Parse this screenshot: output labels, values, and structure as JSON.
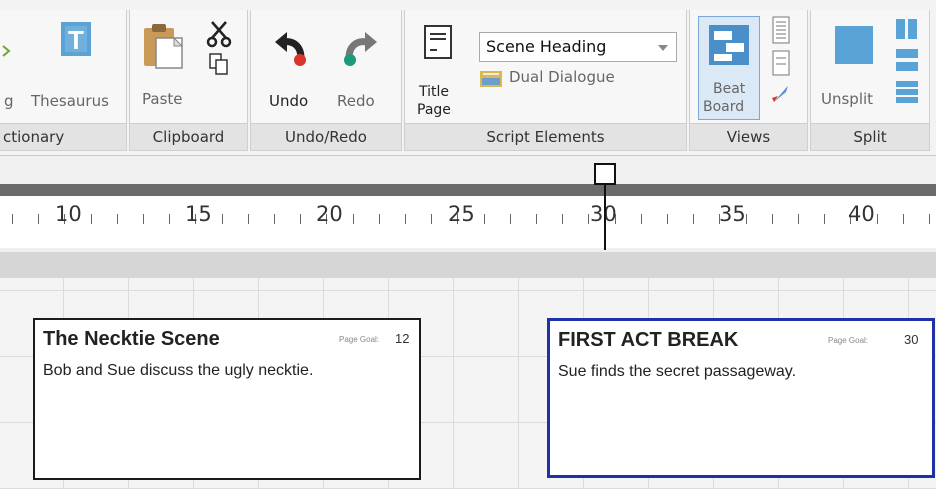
{
  "ribbon": {
    "groups": {
      "dictionary": {
        "label": "ctionary",
        "thesaurus_partial": "g",
        "thesaurus_label": "Thesaurus"
      },
      "clipboard": {
        "label": "Clipboard",
        "paste_label": "Paste"
      },
      "undo_redo": {
        "label": "Undo/Redo",
        "undo_label": "Undo",
        "redo_label": "Redo"
      },
      "script_elements": {
        "label": "Script Elements",
        "title_page_line1": "Title",
        "title_page_line2": "Page",
        "element_select_value": "Scene Heading",
        "dual_dialogue_label": "Dual Dialogue"
      },
      "views": {
        "label": "Views",
        "beat_board_line1": "Beat",
        "beat_board_line2": "Board"
      },
      "split": {
        "label": "Split",
        "unsplit_label": "Unsplit"
      }
    }
  },
  "ruler": {
    "labels": [
      "10",
      "15",
      "20",
      "25",
      "30",
      "35",
      "40"
    ],
    "current_page": 30
  },
  "cards": [
    {
      "title": "The Necktie Scene",
      "goal_label": "Page Goal:",
      "goal_value": "12",
      "body": "Bob and Sue discuss the ugly necktie.",
      "selected": false
    },
    {
      "title": "FIRST ACT BREAK",
      "goal_label": "Page Goal:",
      "goal_value": "30",
      "body": "Sue finds the secret passageway.",
      "selected": true
    }
  ],
  "colors": {
    "selected_border": "#1f31a7",
    "undo_red": "#d9352b",
    "icon_blue": "#4a8fc7"
  }
}
